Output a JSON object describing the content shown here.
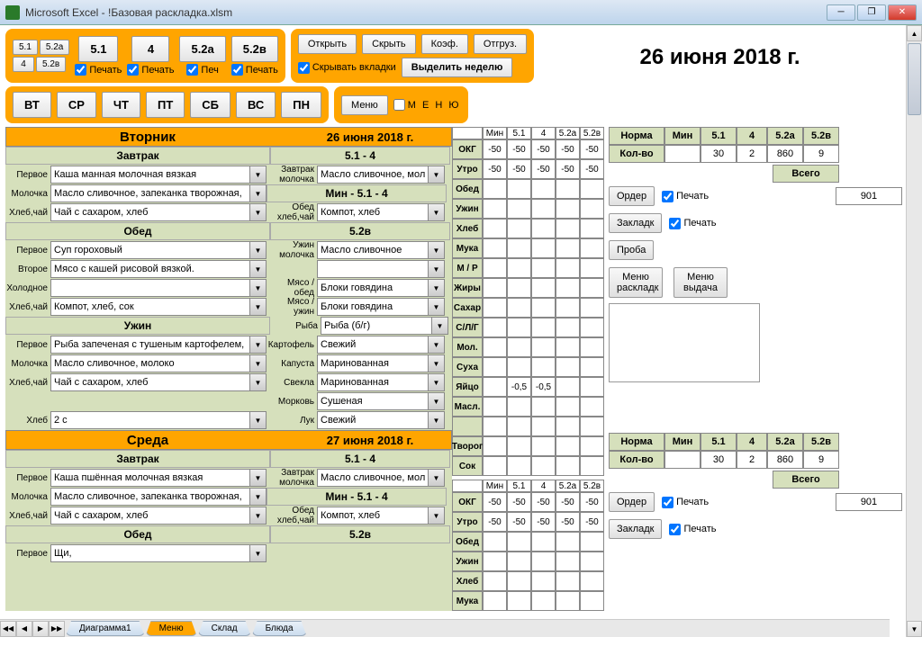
{
  "window": {
    "title": "Microsoft Excel - !Базовая раскладка.xlsm"
  },
  "toolbar1": {
    "mini": [
      "5.1",
      "5.2а",
      "4",
      "5.2в"
    ],
    "big": [
      "5.1",
      "4",
      "5.2а",
      "5.2в"
    ],
    "print": "Печать"
  },
  "toolbar2": {
    "open": "Открыть",
    "hide": "Скрыть",
    "coef": "Коэф.",
    "ship": "Отгруз.",
    "hidetabs": "Скрывать вкладки",
    "selectweek": "Выделить неделю"
  },
  "days": {
    "vt": "ВТ",
    "sr": "СР",
    "cht": "ЧТ",
    "pt": "ПТ",
    "sb": "СБ",
    "vs": "ВС",
    "pn": "ПН"
  },
  "menu_btn": "Меню",
  "menu_chk": "М Е Н Ю",
  "date_title": "26 июня 2018 г.",
  "mid_header": [
    "Мин",
    "5.1",
    "4",
    "5.2а",
    "5.2в"
  ],
  "mid_rows": [
    "ОКГ",
    "Утро",
    "Обед",
    "Ужин",
    "Хлеб",
    "Мука",
    "М / Р",
    "Жиры",
    "Сахар",
    "С/Л/Г",
    "Мол.",
    "Суха",
    "Яйцо",
    "Масл.",
    "",
    "Творог",
    "Сок"
  ],
  "mid_vals": {
    "r0": [
      "-50",
      "-50",
      "-50",
      "-50",
      "-50"
    ],
    "r1": [
      "-50",
      "-50",
      "-50",
      "-50",
      "-50"
    ],
    "r12": [
      "",
      "-0,5",
      "-0,5",
      "",
      ""
    ]
  },
  "right": {
    "headers": [
      "Норма",
      "Мин",
      "5.1",
      "4",
      "5.2а",
      "5.2в"
    ],
    "kolvo": "Кол-во",
    "vals": [
      "",
      "30",
      "2",
      "860",
      "9"
    ],
    "total_lbl": "Всего",
    "total_val": "901",
    "order": "Ордер",
    "print": "Печать",
    "zaklad": "Закладк",
    "proba": "Проба",
    "menu_r": "Меню раскладк",
    "menu_v": "Меню выдача"
  },
  "tue": {
    "name": "Вторник",
    "date": "26 июня 2018 г.",
    "zavtrak": "Завтрак",
    "obed": "Обед",
    "uzhin": "Ужин",
    "sub1": "5.1 - 4",
    "sub2": "Мин - 5.1 - 4",
    "sub3": "5.2в",
    "labels": {
      "pervoe": "Первое",
      "molochka": "Молочка",
      "hlebchay": "Хлеб,чай",
      "vtoroe": "Второе",
      "holodnoe": "Холодное",
      "hleb": "Хлеб",
      "zavtrak_mol": "Завтрак молочка",
      "obed_hc": "Обед хлеб,чай",
      "uzhin_mol": "Ужин молочка",
      "myaso_obed": "Мясо / обед",
      "myaso_uzhin": "Мясо / ужин",
      "ryba": "Рыба",
      "kartofel": "Картофель",
      "kapusta": "Капуста",
      "svekla": "Свекла",
      "morkov": "Морковь",
      "luk": "Лук"
    },
    "z_pervoe": "Каша манная молочная вязкая",
    "z_mol": "Масло сливочное, запеканка творожная,",
    "z_hc": "Чай с сахаром, хлеб",
    "o_pervoe": "Суп гороховый",
    "o_vtoroe": "Мясо с кашей рисовой вязкой.",
    "o_hol": "",
    "o_hc": "Компот, хлеб, сок",
    "u_pervoe": "Рыба запеченая с тушеным картофелем,",
    "u_mol": "Масло сливочное, молоко",
    "u_hc": "Чай с сахаром, хлеб",
    "hleb_val": "2 с",
    "s_zavmol": "Масло сливочное, молок",
    "s_obedhc": "Компот, хлеб",
    "s_uzhmol": "Масло сливочное",
    "s_mobed": "Блоки говядина",
    "s_muzhin": "Блоки говядина",
    "s_ryba": "Рыба (б/г)",
    "s_kart": "Свежий",
    "s_kap": "Маринованная",
    "s_svek": "Маринованная",
    "s_mork": "Сушеная",
    "s_luk": "Свежий"
  },
  "wed": {
    "name": "Среда",
    "date": "27 июня 2018 г.",
    "z_pervoe": "Каша пшённая молочная вязкая",
    "z_mol": "Масло сливочное, запеканка творожная,",
    "z_hc": "Чай с сахаром, хлеб",
    "o_pervoe": "Щи,"
  },
  "tabs": [
    "Диаграмма1",
    "Меню",
    "Склад",
    "Блюда"
  ]
}
